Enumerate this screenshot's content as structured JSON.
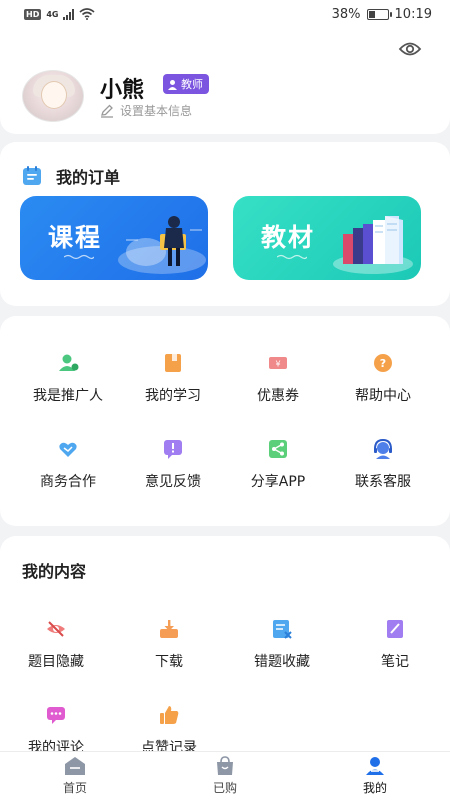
{
  "status_bar": {
    "network": "HD",
    "signal_type": "4G",
    "battery_percent": "38%",
    "battery_level": 0.38,
    "time": "10:19"
  },
  "profile": {
    "username": "小熊",
    "role_badge": "教师",
    "edit_hint": "设置基本信息"
  },
  "orders": {
    "title": "我的订单",
    "tiles": [
      {
        "label": "课程",
        "color": "#2b8bf2"
      },
      {
        "label": "教材",
        "color": "#2fd8c0"
      }
    ]
  },
  "services": [
    {
      "label": "我是推广人",
      "icon": "promoter-icon",
      "color": "#4cc77f"
    },
    {
      "label": "我的学习",
      "icon": "study-icon",
      "color": "#f5a14a"
    },
    {
      "label": "优惠券",
      "icon": "coupon-icon",
      "color": "#f08a8a"
    },
    {
      "label": "帮助中心",
      "icon": "help-icon",
      "color": "#f5a14a"
    },
    {
      "label": "商务合作",
      "icon": "handshake-icon",
      "color": "#4fa7f0"
    },
    {
      "label": "意见反馈",
      "icon": "feedback-icon",
      "color": "#a07df0"
    },
    {
      "label": "分享APP",
      "icon": "share-icon",
      "color": "#5ccf7a"
    },
    {
      "label": "联系客服",
      "icon": "customer-service-icon",
      "color": "#4f7fe8"
    }
  ],
  "content": {
    "title": "我的内容",
    "items": [
      {
        "label": "题目隐藏",
        "icon": "eye-off-icon",
        "color": "#f07b7b"
      },
      {
        "label": "下载",
        "icon": "download-icon",
        "color": "#f59d54"
      },
      {
        "label": "错题收藏",
        "icon": "wrong-question-icon",
        "color": "#4fa7f0"
      },
      {
        "label": "笔记",
        "icon": "note-icon",
        "color": "#a07df0"
      },
      {
        "label": "我的评论",
        "icon": "comment-icon",
        "color": "#e05bd0"
      },
      {
        "label": "点赞记录",
        "icon": "like-icon",
        "color": "#f5a14a"
      }
    ]
  },
  "bottom_nav": [
    {
      "label": "首页",
      "icon": "home-icon",
      "active": false
    },
    {
      "label": "已购",
      "icon": "bag-icon",
      "active": false
    },
    {
      "label": "我的",
      "icon": "profile-icon",
      "active": true
    }
  ]
}
